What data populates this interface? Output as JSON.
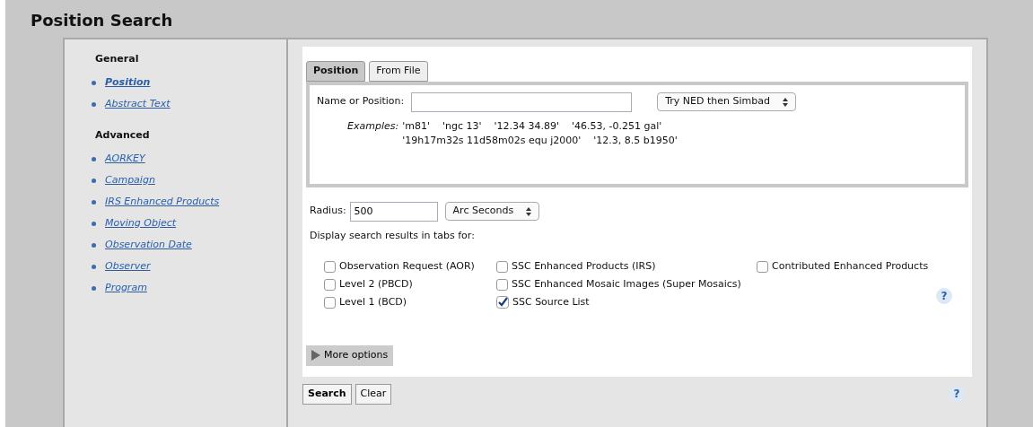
{
  "page_title": "Position Search",
  "sidebar": {
    "sections": [
      {
        "heading": "General",
        "items": [
          {
            "label": "Position",
            "selected": true
          },
          {
            "label": "Abstract Text",
            "selected": false
          }
        ]
      },
      {
        "heading": "Advanced",
        "items": [
          {
            "label": "AORKEY",
            "selected": false
          },
          {
            "label": "Campaign",
            "selected": false
          },
          {
            "label": "IRS Enhanced Products",
            "selected": false
          },
          {
            "label": "Moving Object",
            "selected": false
          },
          {
            "label": "Observation Date",
            "selected": false
          },
          {
            "label": "Observer",
            "selected": false
          },
          {
            "label": "Program",
            "selected": false
          }
        ]
      }
    ]
  },
  "tabs": [
    {
      "label": "Position",
      "selected": true
    },
    {
      "label": "From File",
      "selected": false
    }
  ],
  "name_field": {
    "label": "Name or Position:",
    "resolver": "Try NED then Simbad"
  },
  "examples": {
    "label": "Examples:",
    "lines": [
      [
        "'m81'",
        "'ngc 13'",
        "'12.34 34.89'",
        "'46.53, -0.251 gal'"
      ],
      [
        "'19h17m32s 11d58m02s equ j2000'",
        "'12.3, 8.5 b1950'"
      ]
    ]
  },
  "radius": {
    "label": "Radius:",
    "value": "500",
    "unit": "Arc Seconds"
  },
  "results_label": "Display search results in tabs for:",
  "checkbox_columns": [
    [
      {
        "label": "Observation Request (AOR)",
        "checked": false
      },
      {
        "label": "Level 2 (PBCD)",
        "checked": false
      },
      {
        "label": "Level 1 (BCD)",
        "checked": false
      }
    ],
    [
      {
        "label": "SSC Enhanced Products (IRS)",
        "checked": false
      },
      {
        "label": "SSC Enhanced Mosaic Images (Super Mosaics)",
        "checked": false
      },
      {
        "label": "SSC Source List",
        "checked": true
      }
    ],
    [
      {
        "label": "Contributed Enhanced Products",
        "checked": false
      }
    ]
  ],
  "help_mark": "?",
  "more_options": {
    "label": "More options",
    "expanded": false
  },
  "buttons": [
    "Search",
    "Clear"
  ],
  "footer_help": "?"
}
